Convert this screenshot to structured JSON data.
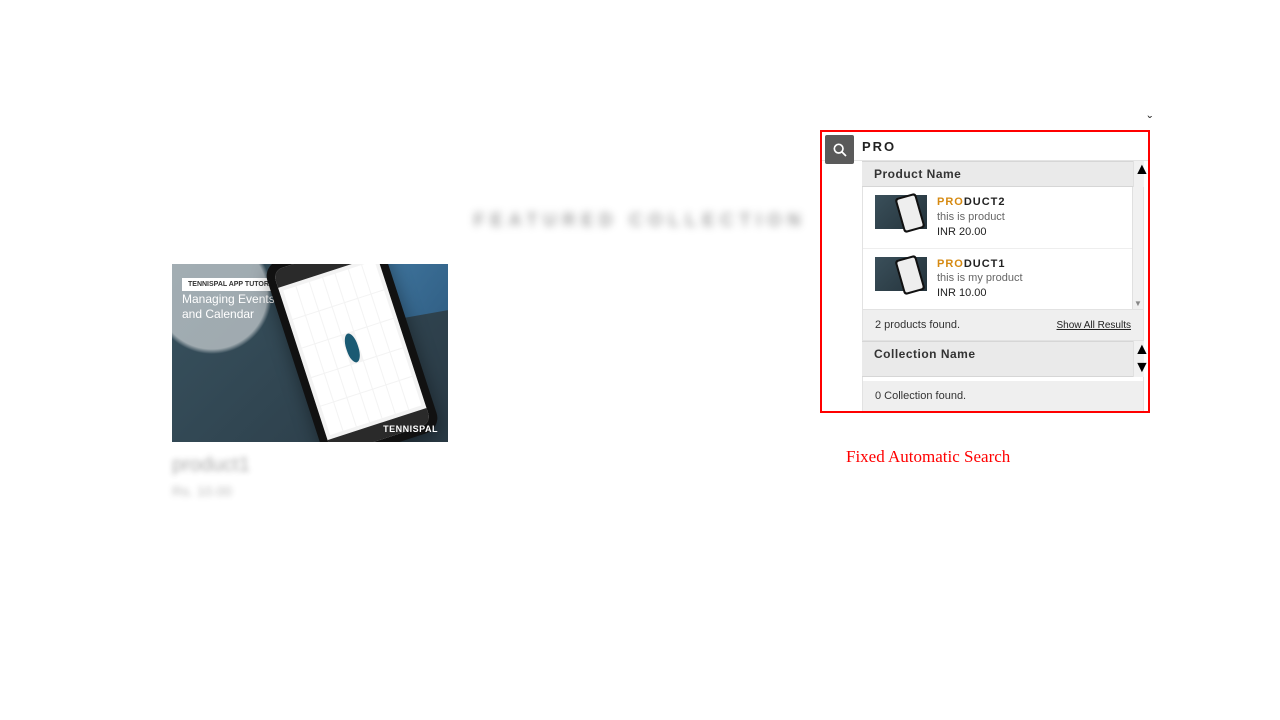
{
  "background": {
    "featured_heading": "FEATURED COLLECTION",
    "product_card": {
      "tag": "TENNISPAL APP TUTORIAL",
      "overlay_line1": "Managing Events",
      "overlay_line2": "and Calendar",
      "logo": "TENNISPAL",
      "title": "product1",
      "price": "Rs. 10.00"
    }
  },
  "search": {
    "query": "PRO",
    "product_header": "Product Name",
    "collection_header": "Collection Name",
    "products_found_text": "2 products found.",
    "show_all_label": "Show All Results",
    "collections_found_text": "0 Collection found.",
    "results": [
      {
        "title_prefix": "PRO",
        "title_rest": "DUCT2",
        "desc": "this is product",
        "price": "INR 20.00"
      },
      {
        "title_prefix": "PRO",
        "title_rest": "DUCT1",
        "desc": "this is my product",
        "price": "INR 10.00"
      }
    ]
  },
  "caption": "Fixed Automatic Search"
}
